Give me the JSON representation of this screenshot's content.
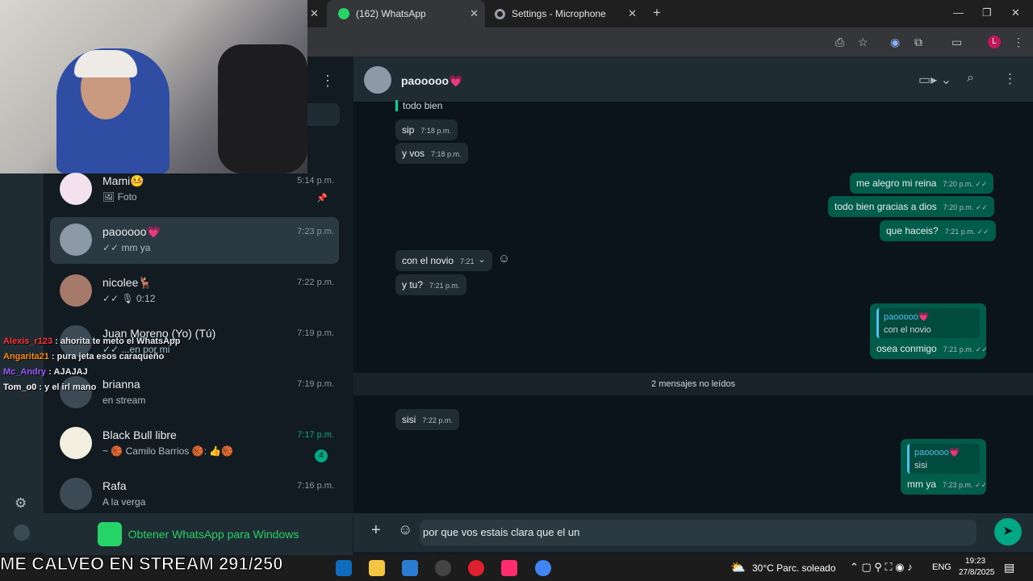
{
  "browser": {
    "tabs": [
      {
        "label": "(162) WhatsApp",
        "active": true
      },
      {
        "label": "Settings - Microphone",
        "active": false
      }
    ],
    "profile_initial": "L"
  },
  "stream_overlay": {
    "chat": [
      {
        "user": "Alexis_r123",
        "text": ": ahorita te meto el WhatsApp",
        "color": "#ff3333"
      },
      {
        "user": "Angarita21",
        "text": ": pura jeta esos caraqueño",
        "color": "#ff8c00"
      },
      {
        "user": "Mc_Andry",
        "text": ": AJAJAJ",
        "color": "#9b59ff"
      },
      {
        "user": "Tom_o0",
        "text": ": y el irl mano",
        "color": "#ffffff"
      }
    ],
    "ticker": "ME CALVEO EN STREAM 291/250"
  },
  "chatlist": [
    {
      "name": "Mami🤒",
      "sub": "🖼 Foto",
      "time": "5:14 p.m.",
      "pinned": true
    },
    {
      "name": "paooooo💗",
      "sub": "✓✓ mm ya",
      "time": "7:23 p.m.",
      "selected": true
    },
    {
      "name": "nicolee🦌",
      "sub": "✓✓ 🎙 0:12",
      "time": "7:22 p.m."
    },
    {
      "name": "Juan Moreno (Yo) (Tú)",
      "sub": "✓✓ ...en por mi",
      "time": "7:19 p.m."
    },
    {
      "name": "brianna",
      "sub": "en stream",
      "time": "7:19 p.m."
    },
    {
      "name": "Black Bull libre",
      "sub": "~ 🏀 Camilo Barrios 🏀: 👍🏀",
      "time": "7:17 p.m.",
      "unread": "4"
    },
    {
      "name": "Rafa",
      "sub": "A la verga",
      "time": "7:16 p.m."
    }
  ],
  "promo": "Obtener WhatsApp para Windows",
  "chat_header": {
    "name": "paooooo💗"
  },
  "messages": {
    "m1": {
      "quote": "todo bien"
    },
    "m2": {
      "text": "sip",
      "time": "7:18 p.m."
    },
    "m3": {
      "text": "y vos",
      "time": "7:18 p.m."
    },
    "m4": {
      "text": "me alegro mi reina",
      "time": "7:20 p.m. ✓✓"
    },
    "m5": {
      "text": "todo bien gracias a dios",
      "time": "7:20 p.m. ✓✓"
    },
    "m6": {
      "text": "que haceis?",
      "time": "7:21 p.m. ✓✓"
    },
    "m7": {
      "text": "con el novio",
      "time": "7:21"
    },
    "m8": {
      "text": "y tu?",
      "time": "7:21 p.m."
    },
    "m9": {
      "qname": "paooooo💗",
      "qtext": "con el novio",
      "text": "osea conmigo",
      "time": "7:21 p.m. ✓✓"
    },
    "unread_divider": "2 mensajes no leídos",
    "m10": {
      "text": "sisi",
      "time": "7:22 p.m."
    },
    "m11": {
      "qname": "paooooo💗",
      "qtext": "sisi",
      "text": "mm ya",
      "time": "7:23 p.m. ✓✓"
    }
  },
  "composer": {
    "value": "por que vos estais clara que el un"
  },
  "taskbar": {
    "weather": "30°C  Parc. soleado",
    "lang": "ENG",
    "time": "19:23",
    "date": "27/8/2025"
  }
}
